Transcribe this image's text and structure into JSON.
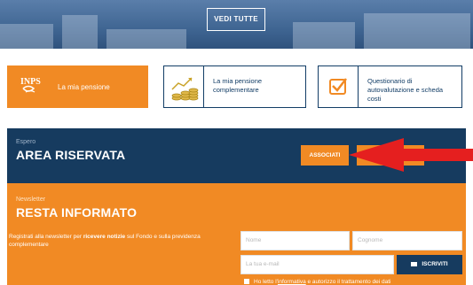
{
  "hero": {
    "button_label": "VEDI TUTTE"
  },
  "cards": [
    {
      "logo_text": "INPS",
      "label": "La mia pensione"
    },
    {
      "label_line1": "La mia pensione",
      "label_line2": "complementare"
    },
    {
      "label_line1": "Questionario di",
      "label_line2": "autovalutazione e scheda costi"
    }
  ],
  "area": {
    "subtitle": "Espero",
    "title": "AREA RISERVATA",
    "associati_label": "ASSOCIATI"
  },
  "newsletter": {
    "subtitle": "Newsletter",
    "title": "RESTA INFORMATO",
    "desc_prefix": "Registrati alla newsletter per ",
    "desc_bold": "ricevere notizie",
    "desc_suffix": " sul Fondo e sulla previdenza complementare",
    "nome_placeholder": "Nome",
    "cognome_placeholder": "Cognome",
    "email_placeholder": "La tua e-mail",
    "submit_label": "ISCRIVITI",
    "privacy_prefix": "Ho letto l'",
    "privacy_link": "informativa",
    "privacy_suffix": " e autorizzo il trattamento dei dati"
  },
  "colors": {
    "orange": "#f18a24",
    "navy": "#163b5f",
    "arrow": "#e51f1f"
  }
}
